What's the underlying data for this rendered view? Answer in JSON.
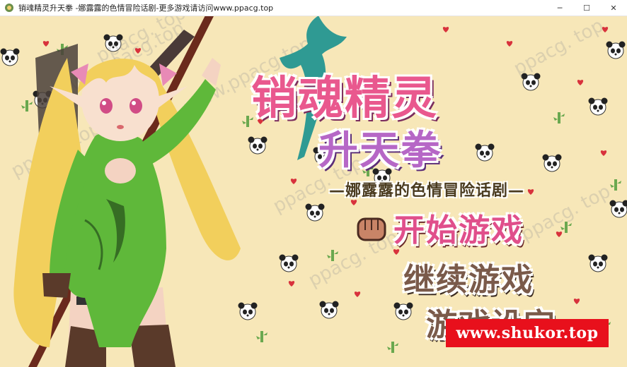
{
  "window": {
    "title": "销魂精灵升天拳 -娜露露的色情冒险话剧-更多游戏请访问www.ppacg.top",
    "minimize": "─",
    "maximize": "☐",
    "close": "✕"
  },
  "game": {
    "title_main": "销魂精灵",
    "title_sub": "升天拳",
    "subtitle": "—娜露露的色情冒险话剧—",
    "menu": {
      "start": "开始游戏",
      "continue": "继续游戏",
      "settings": "游戏设定"
    }
  },
  "watermarks": [
    "www.ppacg.top",
    "www.ppacg.top",
    "ppacg. top",
    "ppacg. top",
    "ppacg. top",
    "ppacg. top",
    "ppacg. top",
    "ppacg. top"
  ],
  "banner": {
    "text": "www.shukor.top"
  },
  "colors": {
    "background": "#f7e7b8",
    "title_pink": "#e9588e",
    "title_purple": "#b667c6",
    "banner_red": "#e8101c",
    "dress_green": "#5fb83a",
    "hair_blonde": "#f5d76e"
  }
}
